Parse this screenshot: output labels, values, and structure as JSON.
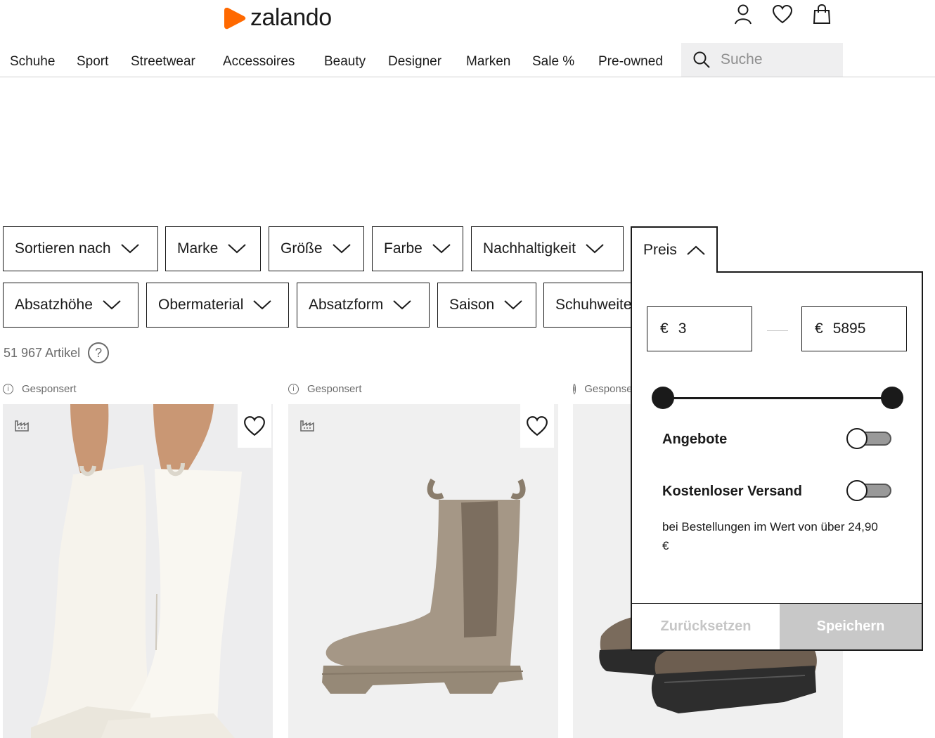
{
  "brand": {
    "name": "zalando",
    "color": "#ff6900"
  },
  "header": {
    "icons": [
      "user-icon",
      "heart-icon",
      "bag-icon"
    ]
  },
  "nav": {
    "items": [
      {
        "label": "Schuhe"
      },
      {
        "label": "Sport"
      },
      {
        "label": "Streetwear"
      },
      {
        "label": "Accessoires"
      },
      {
        "label": "Beauty"
      },
      {
        "label": "Designer"
      },
      {
        "label": "Marken"
      },
      {
        "label": "Sale %"
      },
      {
        "label": "Pre-owned"
      }
    ],
    "search_placeholder": "Suche"
  },
  "filters": {
    "row1": [
      {
        "label": "Sortieren nach"
      },
      {
        "label": "Marke"
      },
      {
        "label": "Größe"
      },
      {
        "label": "Farbe"
      },
      {
        "label": "Nachhaltigkeit"
      },
      {
        "label": "Preis",
        "open": true
      }
    ],
    "row2": [
      {
        "label": "Absatzhöhe"
      },
      {
        "label": "Obermaterial"
      },
      {
        "label": "Absatzform"
      },
      {
        "label": "Saison"
      },
      {
        "label": "Schuhweite"
      }
    ]
  },
  "results": {
    "count_text": "51 967 Artikel",
    "help": "?"
  },
  "products": [
    {
      "sponsor_label": "Gesponsert",
      "image": "white-knee-high-boots"
    },
    {
      "sponsor_label": "Gesponsert",
      "image": "taupe-chelsea-boot"
    },
    {
      "sponsor_label": "Gesponsert",
      "image": "brown-lug-sole-boots"
    }
  ],
  "price_panel": {
    "currency": "€",
    "min_value": "3",
    "max_value": "5895",
    "slider_min_fraction": 0,
    "slider_max_fraction": 1,
    "options": [
      {
        "label": "Angebote",
        "on": false
      },
      {
        "label": "Kostenloser Versand",
        "on": false
      }
    ],
    "shipping_note": "bei Bestellungen im Wert von über 24,90 €",
    "reset_label": "Zurücksetzen",
    "save_label": "Speichern"
  }
}
